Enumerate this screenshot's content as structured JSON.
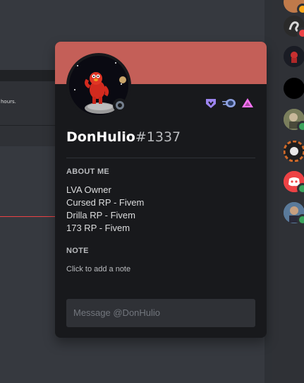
{
  "background": {
    "message_snippet": "hours."
  },
  "profile": {
    "username": "DonHulio",
    "discriminator": "#1337",
    "banner_color": "#c45f58",
    "status": "offline",
    "badges": [
      "hypesquad-balance-icon",
      "early-supporter-icon",
      "nitro-boost-icon"
    ],
    "about_me_title": "ABOUT ME",
    "about_me_lines": [
      "LVA Owner",
      "Cursed RP - Fivem",
      "Drilla RP - Fivem",
      "173 RP - Fivem"
    ],
    "note_title": "NOTE",
    "note_placeholder": "Click to add a note",
    "message_placeholder": "Message @DonHulio"
  },
  "member_list": {
    "avatars": [
      {
        "name": "member-avatar-1",
        "color": "#c07a4a",
        "status": "idle"
      },
      {
        "name": "member-avatar-2",
        "color": "#3a3a3a",
        "status": "dnd"
      },
      {
        "name": "member-avatar-3",
        "color": "#20222a",
        "status": "none"
      },
      {
        "name": "member-avatar-4",
        "color": "#000000",
        "status": "none"
      },
      {
        "name": "member-avatar-5",
        "color": "#8a8f6a",
        "status": "online"
      },
      {
        "name": "member-avatar-6",
        "color": "#d06a2a",
        "status": "none"
      },
      {
        "name": "member-avatar-7",
        "color": "#ed4245",
        "status": "online"
      },
      {
        "name": "member-avatar-8",
        "color": "#6a88aa",
        "status": "online"
      }
    ]
  },
  "colors": {
    "online": "#3ba55d",
    "idle": "#faa81a",
    "dnd": "#ed4245",
    "offline": "#747f8d"
  }
}
